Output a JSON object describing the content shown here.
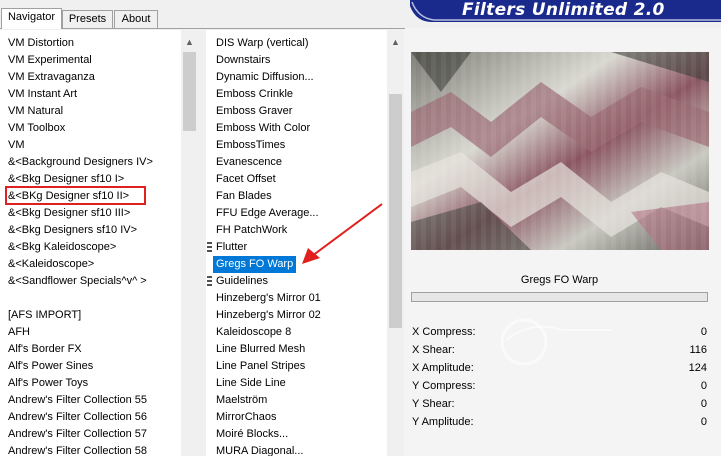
{
  "tabs": [
    {
      "label": "Navigator",
      "active": true
    },
    {
      "label": "Presets",
      "active": false
    },
    {
      "label": "About",
      "active": false
    }
  ],
  "title": "Filters Unlimited 2.0",
  "categories": [
    "VM Distortion",
    "VM Experimental",
    "VM Extravaganza",
    "VM Instant Art",
    "VM Natural",
    "VM Toolbox",
    "VM",
    "&<Background Designers IV>",
    "&<Bkg Designer sf10 I>",
    "&<BKg Designer sf10 II>",
    "&<Bkg Designer sf10 III>",
    "&<Bkg Designers sf10 IV>",
    "&<Bkg Kaleidoscope>",
    "&<Kaleidoscope>",
    "&<Sandflower Specials^v^ >",
    "",
    "[AFS IMPORT]",
    "AFH",
    "Alf's Border FX",
    "Alf's Power Sines",
    "Alf's Power Toys",
    "Andrew's Filter Collection 55",
    "Andrew's Filter Collection 56",
    "Andrew's Filter Collection 57",
    "Andrew's Filter Collection 58"
  ],
  "filters": [
    {
      "label": "DIS Warp (vertical)",
      "grip": false
    },
    {
      "label": "Downstairs",
      "grip": false
    },
    {
      "label": "Dynamic Diffusion...",
      "grip": false
    },
    {
      "label": "Emboss Crinkle",
      "grip": false
    },
    {
      "label": "Emboss Graver",
      "grip": false
    },
    {
      "label": "Emboss With Color",
      "grip": false
    },
    {
      "label": "EmbossTimes",
      "grip": false
    },
    {
      "label": "Evanescence",
      "grip": false
    },
    {
      "label": "Facet Offset",
      "grip": false
    },
    {
      "label": "Fan Blades",
      "grip": false
    },
    {
      "label": "FFU Edge Average...",
      "grip": false
    },
    {
      "label": "FH PatchWork",
      "grip": false
    },
    {
      "label": "Flutter",
      "grip": true
    },
    {
      "label": "Gregs FO Warp",
      "grip": false,
      "selected": true
    },
    {
      "label": "Guidelines",
      "grip": true
    },
    {
      "label": "Hinzeberg's Mirror 01",
      "grip": false
    },
    {
      "label": "Hinzeberg's Mirror 02",
      "grip": false
    },
    {
      "label": "Kaleidoscope 8",
      "grip": false
    },
    {
      "label": "Line Blurred Mesh",
      "grip": false
    },
    {
      "label": "Line Panel Stripes",
      "grip": false
    },
    {
      "label": "Line Side Line",
      "grip": false
    },
    {
      "label": "Maelström",
      "grip": false
    },
    {
      "label": "MirrorChaos",
      "grip": false
    },
    {
      "label": "Moiré Blocks...",
      "grip": false
    },
    {
      "label": "MURA Diagonal...",
      "grip": false
    }
  ],
  "selected_filter": "Gregs FO Warp",
  "params": [
    {
      "label": "X Compress:",
      "value": "0"
    },
    {
      "label": "X Shear:",
      "value": "116"
    },
    {
      "label": "X Amplitude:",
      "value": "124"
    },
    {
      "label": "Y Compress:",
      "value": "0"
    },
    {
      "label": "Y Shear:",
      "value": "0"
    },
    {
      "label": "Y Amplitude:",
      "value": "0"
    }
  ],
  "colors": {
    "selection": "#0078d7",
    "highlight_box": "#e0201e",
    "arrow": "#e0201e",
    "title_banner": "#1a2a8c"
  }
}
